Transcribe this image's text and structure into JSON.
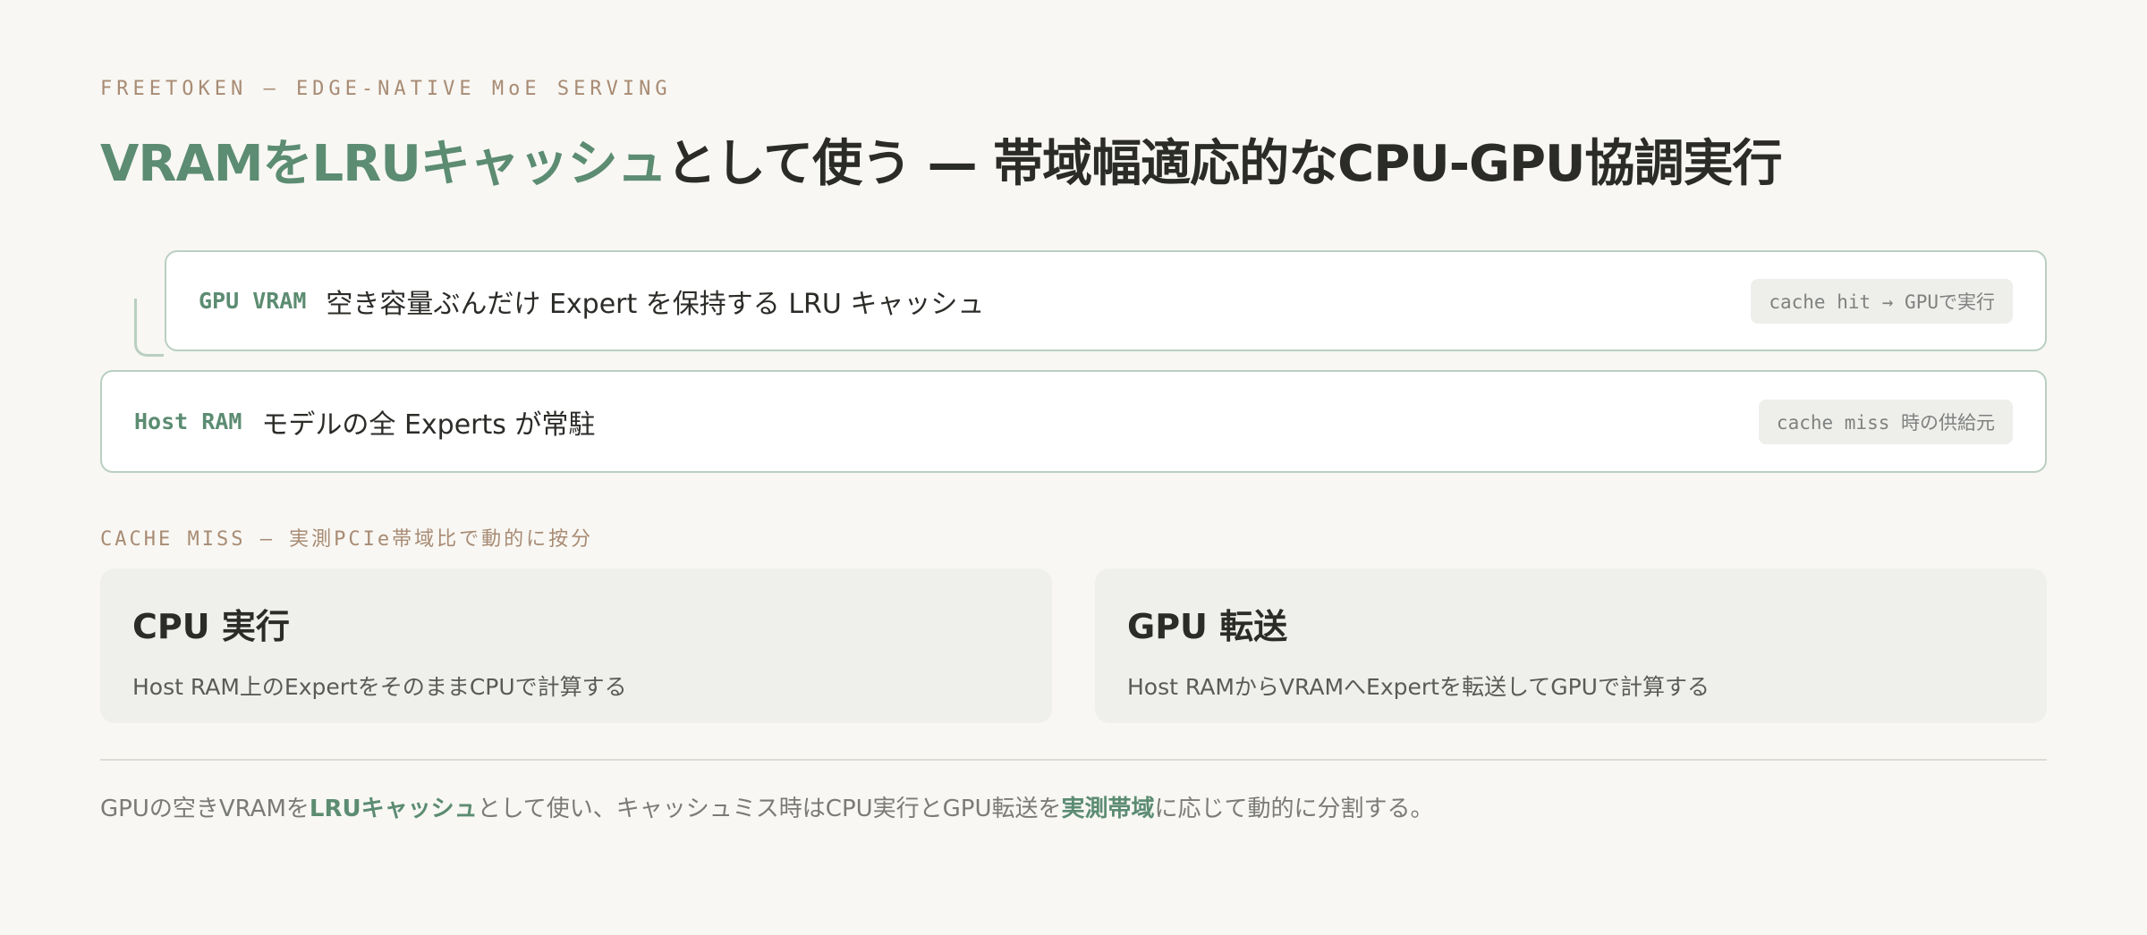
{
  "header": {
    "eyebrow": "FREETOKEN — EDGE-NATIVE MoE SERVING",
    "title_accent": "VRAMをLRUキャッシュ",
    "title_rest": "として使う — 帯域幅適応的なCPU-GPU協調実行"
  },
  "memory_tiers": [
    {
      "tag": "GPU VRAM",
      "desc": "空き容量ぶんだけ Expert を保持する LRU キャッシュ",
      "note": "cache hit → GPUで実行"
    },
    {
      "tag": "Host RAM",
      "desc": "モデルの全 Experts が常駐",
      "note": "cache miss 時の供給元"
    }
  ],
  "cache_miss": {
    "label": "CACHE MISS — 実測PCIe帯域比で動的に按分",
    "options": [
      {
        "title": "CPU 実行",
        "desc": "Host RAM上のExpertをそのままCPUで計算する"
      },
      {
        "title": "GPU 転送",
        "desc": "Host RAMからVRAMへExpertを転送してGPUで計算する"
      }
    ]
  },
  "summary": {
    "part1": "GPUの空きVRAMを",
    "hl1": "LRUキャッシュ",
    "part2": "として使い、キャッシュミス時はCPU実行とGPU転送を",
    "hl2": "実測帯域",
    "part3": "に応じて動的に分割する。"
  },
  "colors": {
    "accent": "#5c8c72",
    "eyebrow": "#a88b74",
    "background": "#f8f7f3",
    "card_border": "#b9cfc1",
    "panel_bg": "#eff0ec"
  }
}
